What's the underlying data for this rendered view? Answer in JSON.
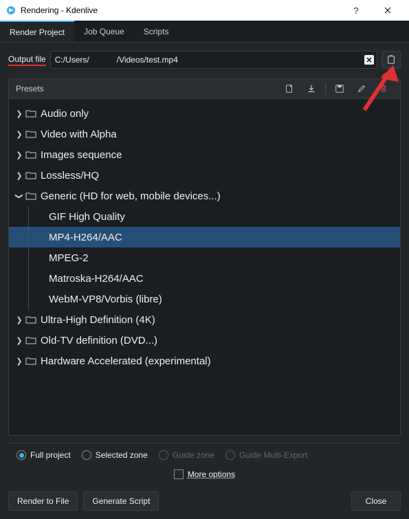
{
  "window": {
    "title": "Rendering - Kdenlive"
  },
  "tabs": {
    "render": "Render Project",
    "jobs": "Job Queue",
    "scripts": "Scripts"
  },
  "output": {
    "label": "Output file",
    "path_pre": "C:/Users/",
    "path_post": "/Videos/test.mp4"
  },
  "presets_label": "Presets",
  "tree": {
    "audio": "Audio only",
    "alpha": "Video with Alpha",
    "images": "Images sequence",
    "lossless": "Lossless/HQ",
    "generic": "Generic (HD for web, mobile devices...)",
    "gif": "GIF High Quality",
    "mp4": "MP4-H264/AAC",
    "mpeg2": "MPEG-2",
    "matroska": "Matroska-H264/AAC",
    "webm": "WebM-VP8/Vorbis (libre)",
    "uhd": "Ultra-High Definition (4K)",
    "oldtv": "Old-TV definition (DVD...)",
    "hw": "Hardware Accelerated (experimental)"
  },
  "options": {
    "full": "Full project",
    "zone": "Selected zone",
    "guide": "Guide zone",
    "multi": "Guide Multi-Export",
    "more": "More options"
  },
  "footer": {
    "render": "Render to File",
    "script": "Generate Script",
    "close": "Close"
  }
}
